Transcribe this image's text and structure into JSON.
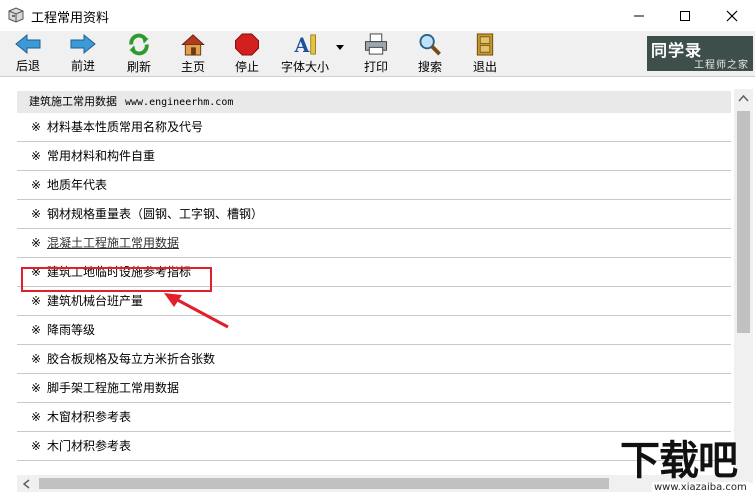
{
  "window": {
    "title": "工程常用资料"
  },
  "toolbar": {
    "back": "后退",
    "forward": "前进",
    "refresh": "刷新",
    "home": "主页",
    "stop": "停止",
    "font_size": "字体大小",
    "print": "打印",
    "search": "搜索",
    "exit": "退出"
  },
  "brand": {
    "main": "同学录",
    "sub": "工程师之家"
  },
  "list": {
    "header_title": "建筑施工常用数据",
    "header_url": "www.engineerhm.com",
    "marker": "※",
    "items": [
      "材料基本性质常用名称及代号",
      "常用材料和构件自重",
      "地质年代表",
      "钢材规格重量表（圆钢、工字钢、槽钢）",
      "混凝土工程施工常用数据",
      "建筑工地临时设施参考指标",
      "建筑机械台班产量",
      "降雨等级",
      "胶合板规格及每立方米折合张数",
      "脚手架工程施工常用数据",
      "木窗材积参考表",
      "木门材积参考表"
    ]
  },
  "watermark": {
    "big": "下载吧",
    "small": "www.xiazaiba.com"
  },
  "colors": {
    "highlight": "#e0202a",
    "brand_bg": "#3e4f4b"
  }
}
